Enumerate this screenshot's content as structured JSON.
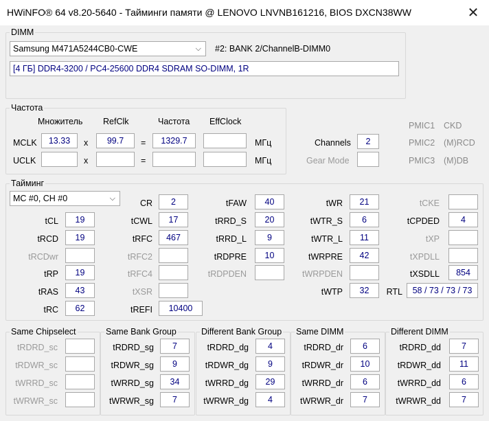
{
  "window": {
    "title": "HWiNFO® 64 v8.20-5640 - Тайминги памяти @ LENOVO LNVNB161216, BIOS DXCN38WW",
    "close_symbol": "✕"
  },
  "dimm": {
    "legend": "DIMM",
    "module_select": "Samsung M471A5244CB0-CWE",
    "slot_info": "#2: BANK 2/ChannelB-DIMM0",
    "description": "[4 ГБ] DDR4-3200 / PC4-25600 DDR4 SDRAM SO-DIMM, 1R"
  },
  "freq": {
    "legend": "Частота",
    "col_multiplier": "Множитель",
    "col_refclk": "RefClk",
    "col_freq": "Частота",
    "col_effclock": "EffClock",
    "mclk_label": "MCLK",
    "mclk_multiplier": "13.33",
    "mclk_refclk": "99.7",
    "mclk_freq": "1329.7",
    "mclk_eff": "",
    "uclk_label": "UCLK",
    "times": "x",
    "equals": "=",
    "unit": "МГц",
    "channels_label": "Channels",
    "channels_value": "2",
    "gear_mode_label": "Gear Mode",
    "gear_mode_value": "",
    "pmic": [
      {
        "name": "PMIC1",
        "value": "CKD"
      },
      {
        "name": "PMIC2",
        "value": "(M)RCD"
      },
      {
        "name": "PMIC3",
        "value": "(M)DB"
      }
    ]
  },
  "timing": {
    "legend": "Тайминг",
    "mc_select": "MC #0, CH #0",
    "tCL": {
      "label": "tCL",
      "value": "19"
    },
    "tRCD": {
      "label": "tRCD",
      "value": "19"
    },
    "tRCDwr": {
      "label": "tRCDwr",
      "value": ""
    },
    "tRP": {
      "label": "tRP",
      "value": "19"
    },
    "tRAS": {
      "label": "tRAS",
      "value": "43"
    },
    "tRC": {
      "label": "tRC",
      "value": "62"
    },
    "CR": {
      "label": "CR",
      "value": "2"
    },
    "tCWL": {
      "label": "tCWL",
      "value": "17"
    },
    "tRFC": {
      "label": "tRFC",
      "value": "467"
    },
    "tRFC2": {
      "label": "tRFC2",
      "value": ""
    },
    "tRFC4": {
      "label": "tRFC4",
      "value": ""
    },
    "tXSR": {
      "label": "tXSR",
      "value": ""
    },
    "tREFI": {
      "label": "tREFI",
      "value": "10400"
    },
    "tFAW": {
      "label": "tFAW",
      "value": "40"
    },
    "tRRD_S": {
      "label": "tRRD_S",
      "value": "20"
    },
    "tRRD_L": {
      "label": "tRRD_L",
      "value": "9"
    },
    "tRDPRE": {
      "label": "tRDPRE",
      "value": "10"
    },
    "tRDPDEN": {
      "label": "tRDPDEN",
      "value": ""
    },
    "tWR": {
      "label": "tWR",
      "value": "21"
    },
    "tWTR_S": {
      "label": "tWTR_S",
      "value": "6"
    },
    "tWTR_L": {
      "label": "tWTR_L",
      "value": "11"
    },
    "tWRPRE": {
      "label": "tWRPRE",
      "value": "42"
    },
    "tWRPDEN": {
      "label": "tWRPDEN",
      "value": ""
    },
    "tWTP": {
      "label": "tWTP",
      "value": "32"
    },
    "tCKE": {
      "label": "tCKE",
      "value": ""
    },
    "tCPDED": {
      "label": "tCPDED",
      "value": "4"
    },
    "tXP": {
      "label": "tXP",
      "value": ""
    },
    "tXPDLL": {
      "label": "tXPDLL",
      "value": ""
    },
    "tXSDLL": {
      "label": "tXSDLL",
      "value": "854"
    },
    "RTL": {
      "label": "RTL",
      "value": "58 / 73 / 73 / 73"
    }
  },
  "same_cs": {
    "legend": "Same Chipselect",
    "rows": [
      {
        "label": "tRDRD_sc",
        "value": ""
      },
      {
        "label": "tRDWR_sc",
        "value": ""
      },
      {
        "label": "tWRRD_sc",
        "value": ""
      },
      {
        "label": "tWRWR_sc",
        "value": ""
      }
    ]
  },
  "same_bg": {
    "legend": "Same Bank Group",
    "rows": [
      {
        "label": "tRDRD_sg",
        "value": "7"
      },
      {
        "label": "tRDWR_sg",
        "value": "9"
      },
      {
        "label": "tWRRD_sg",
        "value": "34"
      },
      {
        "label": "tWRWR_sg",
        "value": "7"
      }
    ]
  },
  "diff_bg": {
    "legend": "Different Bank Group",
    "rows": [
      {
        "label": "tRDRD_dg",
        "value": "4"
      },
      {
        "label": "tRDWR_dg",
        "value": "9"
      },
      {
        "label": "tWRRD_dg",
        "value": "29"
      },
      {
        "label": "tWRWR_dg",
        "value": "4"
      }
    ]
  },
  "same_dimm": {
    "legend": "Same DIMM",
    "rows": [
      {
        "label": "tRDRD_dr",
        "value": "6"
      },
      {
        "label": "tRDWR_dr",
        "value": "10"
      },
      {
        "label": "tWRRD_dr",
        "value": "6"
      },
      {
        "label": "tWRWR_dr",
        "value": "7"
      }
    ]
  },
  "diff_dimm": {
    "legend": "Different DIMM",
    "rows": [
      {
        "label": "tRDRD_dd",
        "value": "7"
      },
      {
        "label": "tRDWR_dd",
        "value": "11"
      },
      {
        "label": "tWRRD_dd",
        "value": "6"
      },
      {
        "label": "tWRWR_dd",
        "value": "7"
      }
    ]
  }
}
